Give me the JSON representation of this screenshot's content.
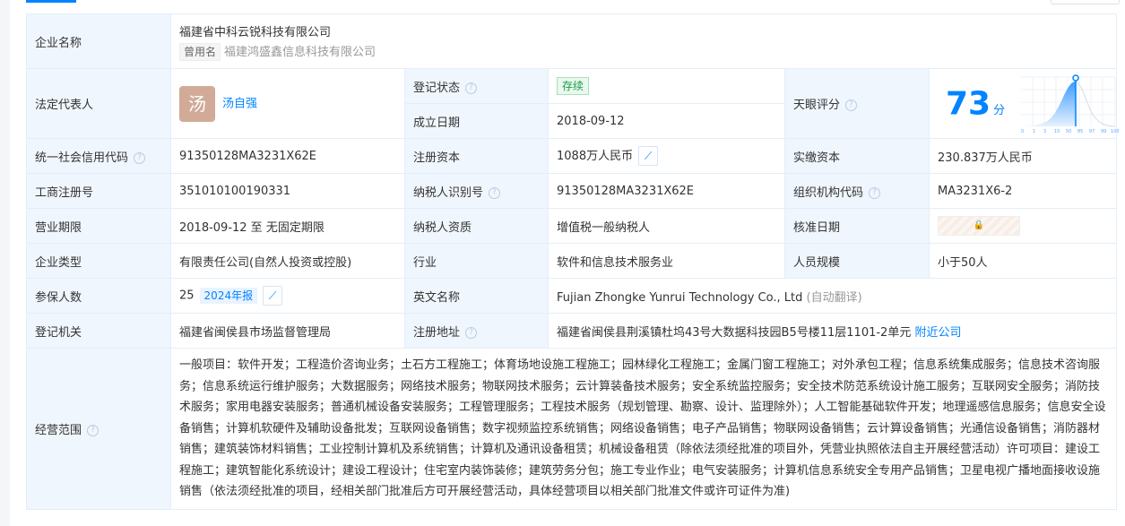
{
  "company": {
    "label": "企业名称",
    "name": "福建省中科云锐科技有限公司",
    "former_tag": "曾用名",
    "former_name": "福建鸿盛鑫信息科技有限公司"
  },
  "legal_rep": {
    "label": "法定代表人",
    "avatar_char": "汤",
    "name": "汤自强"
  },
  "reg_status": {
    "label": "登记状态",
    "value": "存续"
  },
  "found_date": {
    "label": "成立日期",
    "value": "2018-09-12"
  },
  "score": {
    "label": "天眼评分",
    "value": "73",
    "unit": "分",
    "axis": [
      "0",
      "1",
      "3",
      "15",
      "50",
      "85",
      "97",
      "99",
      "100"
    ],
    "percentile_marker": 0.58
  },
  "credit_code": {
    "label": "统一社会信用代码",
    "value": "91350128MA3231X62E"
  },
  "reg_capital": {
    "label": "注册资本",
    "value": "1088万人民币"
  },
  "paid_capital": {
    "label": "实缴资本",
    "value": "230.837万人民币"
  },
  "biz_reg_no": {
    "label": "工商注册号",
    "value": "351010100190331"
  },
  "taxpayer_id": {
    "label": "纳税人识别号",
    "value": "91350128MA3231X62E"
  },
  "org_code": {
    "label": "组织机构代码",
    "value": "MA3231X6-2"
  },
  "term": {
    "label": "营业期限",
    "value": "2018-09-12 至 无固定期限"
  },
  "taxpayer_qual": {
    "label": "纳税人资质",
    "value": "增值税一般纳税人"
  },
  "approve_date": {
    "label": "核准日期"
  },
  "ent_type": {
    "label": "企业类型",
    "value": "有限责任公司(自然人投资或控股)"
  },
  "industry": {
    "label": "行业",
    "value": "软件和信息技术服务业"
  },
  "staff": {
    "label": "人员规模",
    "value": "小于50人"
  },
  "insured": {
    "label": "参保人数",
    "value": "25",
    "report": "2024年报"
  },
  "english": {
    "label": "英文名称",
    "value": "Fujian Zhongke Yunrui Technology Co., Ltd",
    "auto": "(自动翻译)"
  },
  "authority": {
    "label": "登记机关",
    "value": "福建省闽侯县市场监督管理局"
  },
  "address": {
    "label": "注册地址",
    "value": "福建省闽侯县荆溪镇杜坞43号大数据科技园B5号楼11层1101-2单元",
    "nearby": "附近公司"
  },
  "scope": {
    "label": "经营范围",
    "value": "一般项目：软件开发；工程造价咨询业务；土石方工程施工；体育场地设施工程施工；园林绿化工程施工；金属门窗工程施工；对外承包工程；信息系统集成服务；信息技术咨询服务；信息系统运行维护服务；大数据服务；网络技术服务；物联网技术服务；云计算装备技术服务；安全系统监控服务；安全技术防范系统设计施工服务；互联网安全服务；消防技术服务；家用电器安装服务；普通机械设备安装服务；工程管理服务；工程技术服务（规划管理、勘察、设计、监理除外）；人工智能基础软件开发；地理遥感信息服务；信息安全设备销售；计算机软硬件及辅助设备批发；互联网设备销售；数字视频监控系统销售；网络设备销售；电子产品销售；物联网设备销售；云计算设备销售；光通信设备销售；消防器材销售；建筑装饰材料销售；工业控制计算机及系统销售；计算机及通讯设备租赁；机械设备租赁（除依法须经批准的项目外，凭营业执照依法自主开展经营活动）许可项目：建设工程施工；建筑智能化系统设计；建设工程设计；住宅室内装饰装修；建筑劳务分包；施工专业作业；电气安装服务；计算机信息系统安全专用产品销售；卫星电视广播地面接收设施销售（依法须经批准的项目，经相关部门批准后方可开展经营活动，具体经营项目以相关部门批准文件或许可证件为准)"
  },
  "help_icon": "?",
  "trend_icon": "⟋",
  "lock_icon": "🔒"
}
